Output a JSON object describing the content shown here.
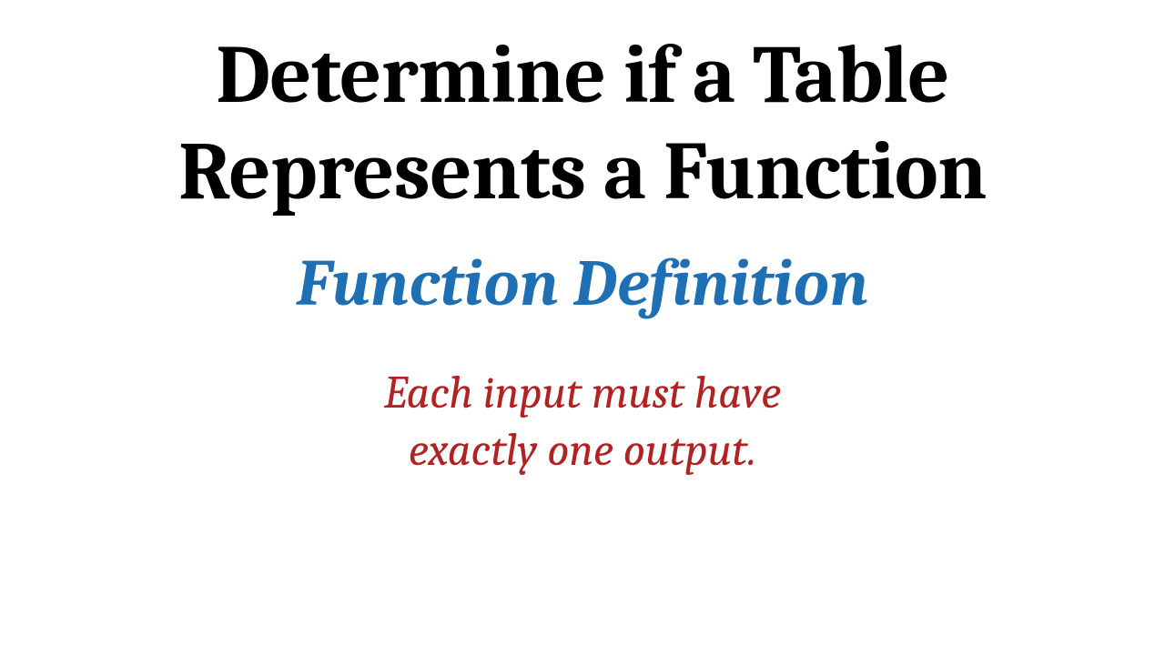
{
  "title_line1": "Determine if a Table",
  "title_line2": "Represents a Function",
  "subtitle": "Function Definition",
  "body_line1": "Each input must have",
  "body_line2": "exactly one output.",
  "colors": {
    "title": "#000000",
    "subtitle": "#1f6fb5",
    "body": "#b22222",
    "background": "#ffffff"
  }
}
